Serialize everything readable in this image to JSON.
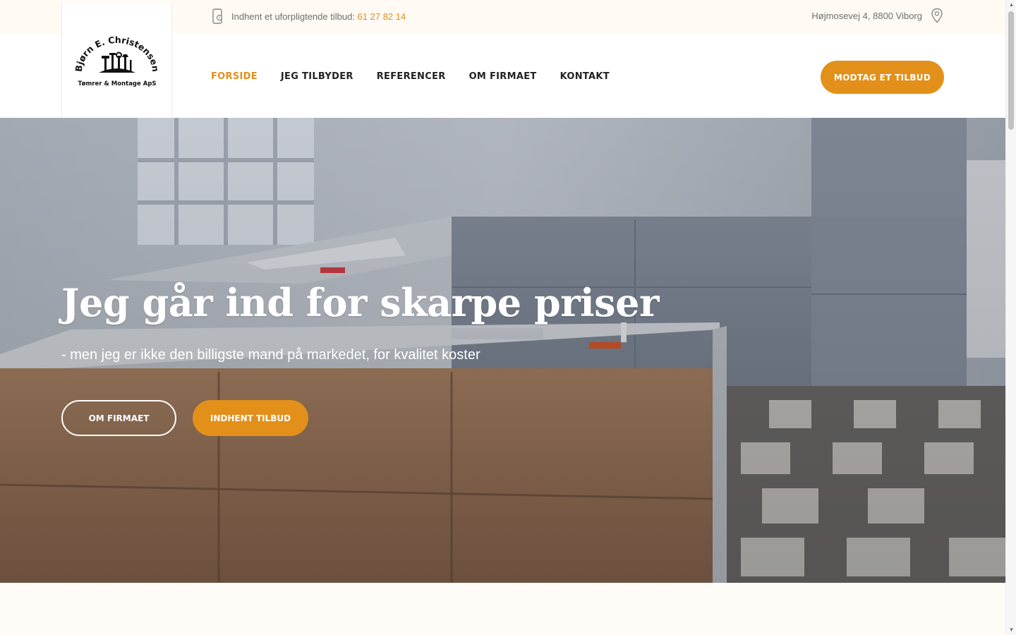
{
  "topbar": {
    "offer_text": "Indhent et uforpligtende tilbud:",
    "phone": "61 27 82 14",
    "address": "Højmosevej 4, 8800 Viborg",
    "icons": {
      "left": "mobile-phone-icon",
      "right": "map-pin-icon"
    }
  },
  "logo": {
    "name": "Bjørn E. Christensen",
    "tagline": "Tømrer & Montage ApS"
  },
  "nav": {
    "items": [
      {
        "label": "FORSIDE",
        "active": true
      },
      {
        "label": "JEG TILBYDER",
        "active": false
      },
      {
        "label": "REFERENCER",
        "active": false
      },
      {
        "label": "OM FIRMAET",
        "active": false
      },
      {
        "label": "KONTAKT",
        "active": false
      }
    ],
    "cta_label": "MODTAG ET TILBUD"
  },
  "hero": {
    "title": "Jeg går ind for skarpe priser",
    "subtitle": "- men jeg er ikke den billigste mand på markedet, for kvalitet koster",
    "btn_about": "OM FIRMAET",
    "btn_quote": "INDHENT TILBUD"
  },
  "colors": {
    "accent": "#e3901a",
    "text_dark": "#222222",
    "text_muted": "#6f6f6f",
    "page_bg": "#fffbf7"
  }
}
